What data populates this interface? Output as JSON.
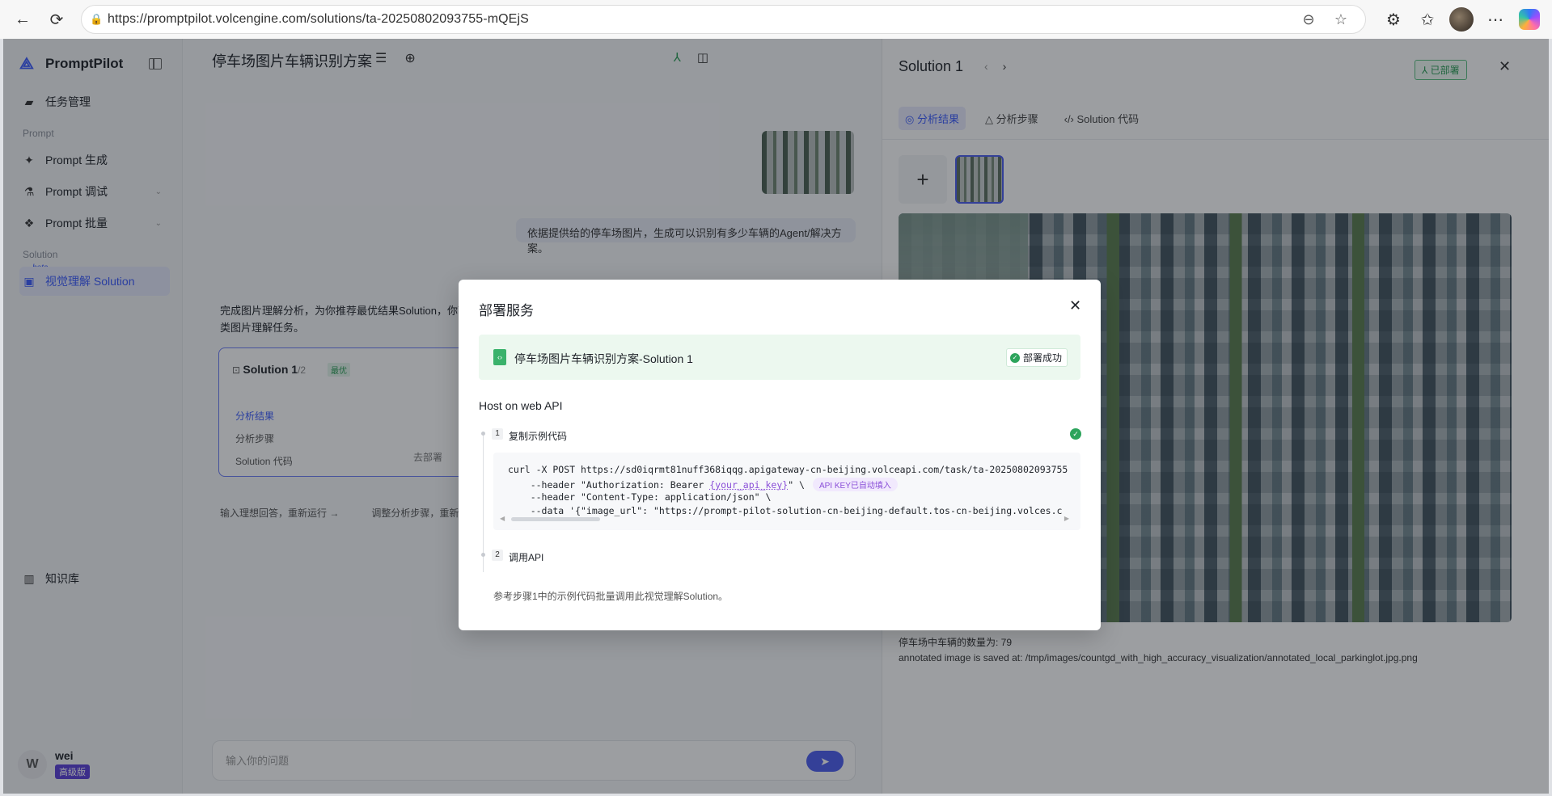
{
  "browser": {
    "url": "https://promptpilot.volcengine.com/solutions/ta-20250802093755-mQEjS"
  },
  "sidebar": {
    "brand": "PromptPilot",
    "task_mgmt": "任务管理",
    "section_prompt": "Prompt",
    "prompt_generate": "Prompt 生成",
    "prompt_debug": "Prompt 调试",
    "prompt_batch": "Prompt 批量",
    "section_solution": "Solution",
    "beta": "beta",
    "vision_solution": "视觉理解 Solution",
    "knowledge": "知识库",
    "user": {
      "initial": "W",
      "name": "wei",
      "plan": "高级版"
    }
  },
  "chat": {
    "title": "停车场图片车辆识别方案",
    "user_message": "依据提供给的停车场图片，生成可以识别有多少车辆的Agent/解决方案。",
    "bot_message": "完成图片理解分析，为你推荐最优结果Solution，你可使用它来处理同类图片理解任务。",
    "card": {
      "title": "Solution 1",
      "count": "/2",
      "tag": "最优",
      "lines": [
        "分析结果",
        "分析步骤",
        "Solution 代码"
      ],
      "deploy_link": "去部署"
    },
    "actions": [
      "输入理想回答，重新运行 →",
      "调整分析步骤，重新运行 →"
    ],
    "input_placeholder": "输入你的问题"
  },
  "panel": {
    "title": "Solution 1",
    "deployed_tag": "已部署",
    "tabs": [
      "分析结果",
      "分析步骤",
      "Solution 代码"
    ],
    "result_lines": [
      "停车场中车辆的数量为: 79",
      "annotated image is saved at: /tmp/images/countgd_with_high_accuracy_visualization/annotated_local_parkinglot.jpg.png"
    ]
  },
  "modal": {
    "title": "部署服务",
    "solution_name": "停车场图片车辆识别方案-Solution 1",
    "status": "部署成功",
    "host_label": "Host on web API",
    "step1_num": "1",
    "step1_title": "复制示例代码",
    "code_line1": "curl -X POST https://sd0iqrmt81nuff368iqqg.apigateway-cn-beijing.volceapi.com/task/ta-20250802093755",
    "code_line2_pre": "    --header \"Authorization: Bearer ",
    "code_key": "{your_api_key}",
    "code_line2_post": "\" \\",
    "api_badge": "API KEY已自动填入",
    "code_line3": "    --header \"Content-Type: application/json\" \\",
    "code_line4": "    --data '{\"image_url\": \"https://prompt-pilot-solution-cn-beijing-default.tos-cn-beijing.volces.c",
    "step2_num": "2",
    "step2_title": "调用API",
    "step2_desc": "参考步骤1中的示例代码批量调用此视觉理解Solution。"
  }
}
